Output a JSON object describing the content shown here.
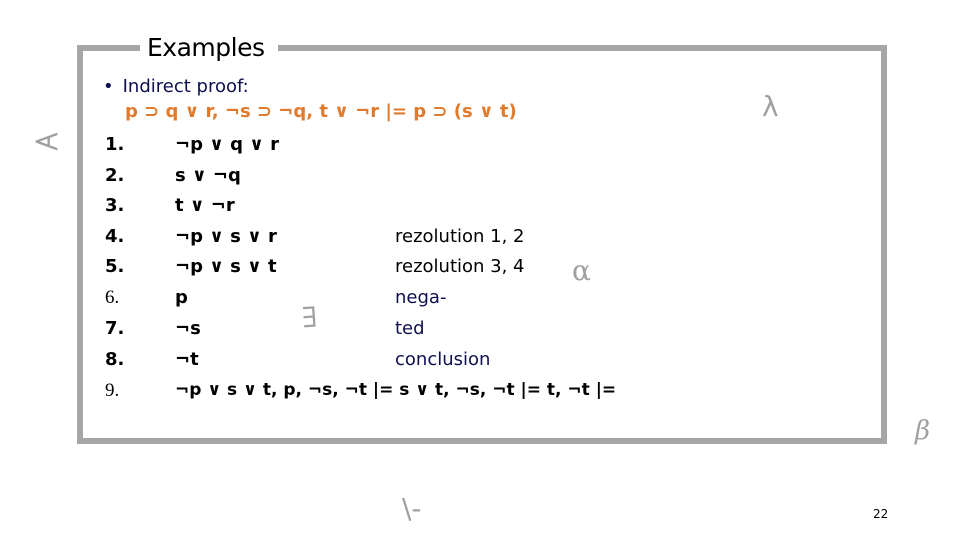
{
  "slide": {
    "title": "Examples",
    "bullet": "Indirect proof:",
    "bullet_marker": "•",
    "premise": "p ⊃ q ∨ r, ¬s ⊃ ¬q, t ∨ ¬r |= p ⊃ (s ∨ t)",
    "steps": [
      {
        "num": "1.",
        "formula": "¬p ∨ q ∨ r",
        "note": ""
      },
      {
        "num": "2.",
        "formula": "s ∨ ¬q",
        "note": ""
      },
      {
        "num": "3.",
        "formula": "t ∨ ¬r",
        "note": ""
      },
      {
        "num": "4.",
        "formula": "¬p ∨ s ∨ r",
        "note": "rezolution 1, 2"
      },
      {
        "num": "5.",
        "formula": "¬p ∨ s ∨ t",
        "note": "rezolution 3, 4"
      },
      {
        "num": "6.",
        "formula": "p",
        "note": "nega-"
      },
      {
        "num": "7.",
        "formula": "¬s",
        "note": "ted"
      },
      {
        "num": "8.",
        "formula": "¬t",
        "note": "conclusion"
      },
      {
        "num": "9.",
        "formula": "¬p ∨ s ∨ t, p, ¬s, ¬t |= s ∨ t, ¬s, ¬t |= t, ¬t |=",
        "note": ""
      }
    ],
    "page_number": "22"
  },
  "decorations": {
    "forall": "∀",
    "lambda": "λ",
    "alpha": "α",
    "exists": "∃",
    "beta": "β",
    "turnstile": "\\-"
  },
  "colors": {
    "premise": "#e07b2e",
    "bullet_text": "#0f0f4f",
    "frame": "#a6a6a6",
    "decoration": "#a0a0a0"
  }
}
